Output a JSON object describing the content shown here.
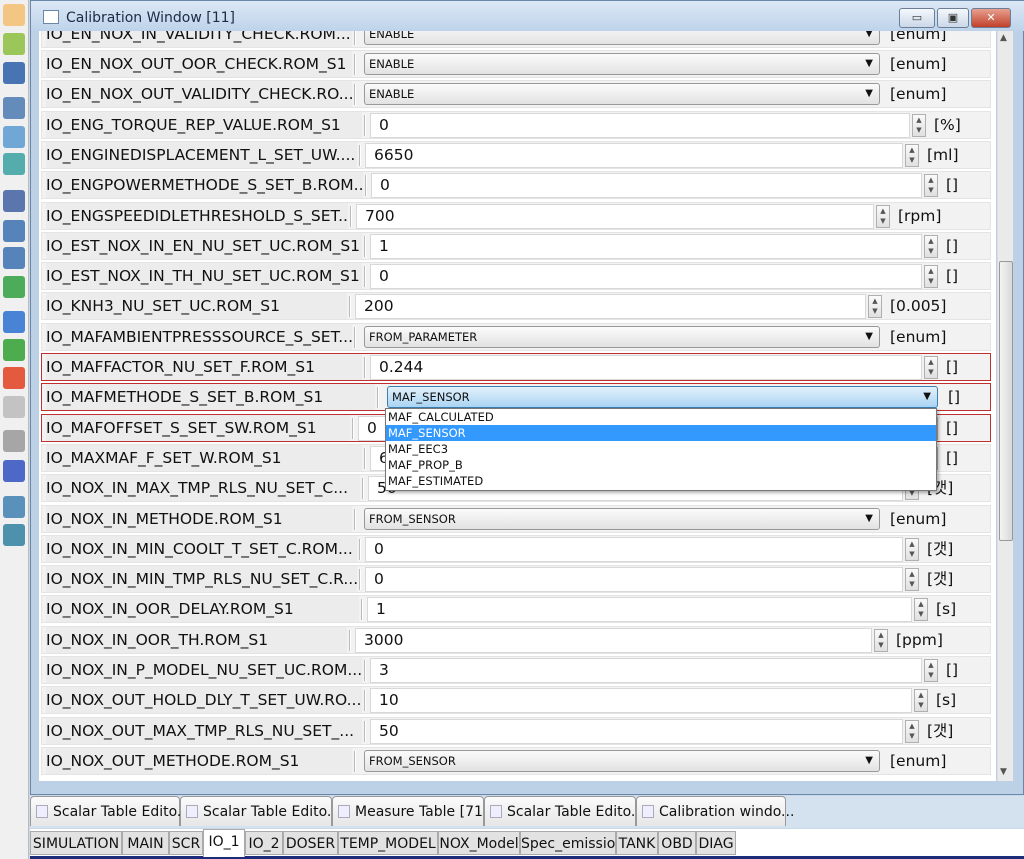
{
  "window": {
    "title": "Calibration Window [11]",
    "minimize": "▭",
    "maximize": "▣",
    "close": "✕"
  },
  "toolbar": {
    "icons": [
      "new-file-icon",
      "open-folder-icon",
      "save-icon",
      "monitor-icon",
      "layers-icon",
      "chart-icon",
      "align-icon",
      "checklist-icon",
      "checklist2-icon",
      "function-icon",
      "stop-square-icon",
      "play-icon",
      "record-icon",
      "pause-icon",
      "print-icon",
      "record-device-icon",
      "search-icon",
      "edit-icon"
    ]
  },
  "rows": [
    {
      "name": "IO_EN_NOX_IN_VALIDITY_CHECK.ROM...",
      "type": "enum",
      "value": "ENABLE",
      "unit": "[enum]"
    },
    {
      "name": "IO_EN_NOX_OUT_OOR_CHECK.ROM_S1",
      "type": "enum",
      "value": "ENABLE",
      "unit": "[enum]"
    },
    {
      "name": "IO_EN_NOX_OUT_VALIDITY_CHECK.RO...",
      "type": "enum",
      "value": "ENABLE",
      "unit": "[enum]"
    },
    {
      "name": "IO_ENG_TORQUE_REP_VALUE.ROM_S1",
      "type": "num",
      "value": "0",
      "unit": "[%]"
    },
    {
      "name": "IO_ENGINEDISPLACEMENT_L_SET_UW....",
      "type": "num",
      "value": "6650",
      "unit": "[ml]"
    },
    {
      "name": "IO_ENGPOWERMETHODE_S_SET_B.ROM...",
      "type": "num",
      "value": "0",
      "unit": "[]"
    },
    {
      "name": "IO_ENGSPEEDIDLETHRESHOLD_S_SET...",
      "type": "num",
      "value": "700",
      "unit": "[rpm]"
    },
    {
      "name": "IO_EST_NOX_IN_EN_NU_SET_UC.ROM_S1",
      "type": "num",
      "value": "1",
      "unit": "[]"
    },
    {
      "name": "IO_EST_NOX_IN_TH_NU_SET_UC.ROM_S1",
      "type": "num",
      "value": "0",
      "unit": "[]"
    },
    {
      "name": "IO_KNH3_NU_SET_UC.ROM_S1",
      "type": "num",
      "value": "200",
      "unit": "[0.005]"
    },
    {
      "name": "IO_MAFAMBIENTPRESSSOURCE_S_SET...",
      "type": "enum",
      "value": "FROM_PARAMETER",
      "unit": "[enum]"
    },
    {
      "name": "IO_MAFFACTOR_NU_SET_F.ROM_S1",
      "type": "num",
      "value": "0.244",
      "unit": "[]",
      "modified": true
    },
    {
      "name": "IO_MAFMETHODE_S_SET_B.ROM_S1",
      "type": "enum",
      "value": "MAF_SENSOR",
      "unit": "[]",
      "modified": true,
      "open": true
    },
    {
      "name": "IO_MAFOFFSET_S_SET_SW.ROM_S1",
      "type": "num",
      "value": "0",
      "unit": "[]",
      "modified": true
    },
    {
      "name": "IO_MAXMAF_F_SET_W.ROM_S1",
      "type": "num",
      "value": "6",
      "unit": "[]"
    },
    {
      "name": "IO_NOX_IN_MAX_TMP_RLS_NU_SET_C...",
      "type": "num",
      "value": "50",
      "unit": "[갯]"
    },
    {
      "name": "IO_NOX_IN_METHODE.ROM_S1",
      "type": "enum",
      "value": "FROM_SENSOR",
      "unit": "[enum]"
    },
    {
      "name": "IO_NOX_IN_MIN_COOLT_T_SET_C.ROM...",
      "type": "num",
      "value": "0",
      "unit": "[갯]"
    },
    {
      "name": "IO_NOX_IN_MIN_TMP_RLS_NU_SET_C.R...",
      "type": "num",
      "value": "0",
      "unit": "[갯]"
    },
    {
      "name": "IO_NOX_IN_OOR_DELAY.ROM_S1",
      "type": "num",
      "value": "1",
      "unit": "[s]"
    },
    {
      "name": "IO_NOX_IN_OOR_TH.ROM_S1",
      "type": "num",
      "value": "3000",
      "unit": "[ppm]"
    },
    {
      "name": "IO_NOX_IN_P_MODEL_NU_SET_UC.ROM...",
      "type": "num",
      "value": "3",
      "unit": "[]"
    },
    {
      "name": "IO_NOX_OUT_HOLD_DLY_T_SET_UW.RO...",
      "type": "num",
      "value": "10",
      "unit": "[s]"
    },
    {
      "name": "IO_NOX_OUT_MAX_TMP_RLS_NU_SET_...",
      "type": "num",
      "value": "50",
      "unit": "[갯]"
    },
    {
      "name": "IO_NOX_OUT_METHODE.ROM_S1",
      "type": "enum",
      "value": "FROM_SENSOR",
      "unit": "[enum]"
    }
  ],
  "dropdown": {
    "options": [
      "MAF_CALCULATED",
      "MAF_SENSOR",
      "MAF_EEC3",
      "MAF_PROP_B",
      "MAF_ESTIMATED"
    ],
    "selected": "MAF_SENSOR"
  },
  "doc_tabs": [
    "Scalar Table Edito...",
    "Scalar Table Edito...",
    "Measure Table [71]",
    "Scalar Table Edito...",
    "Calibration windo..."
  ],
  "sheet_tabs": [
    "SIMULATION",
    "MAIN",
    "SCR",
    "IO_1",
    "IO_2",
    "DOSER",
    "TEMP_MODEL",
    "NOX_Model",
    "Spec_emission",
    "TANK",
    "OBD",
    "DIAG"
  ],
  "active_sheet": "IO_1",
  "colors": {
    "modified_border": "#c03030",
    "selection": "#3399ff",
    "active_border": "#1c2a7a"
  }
}
